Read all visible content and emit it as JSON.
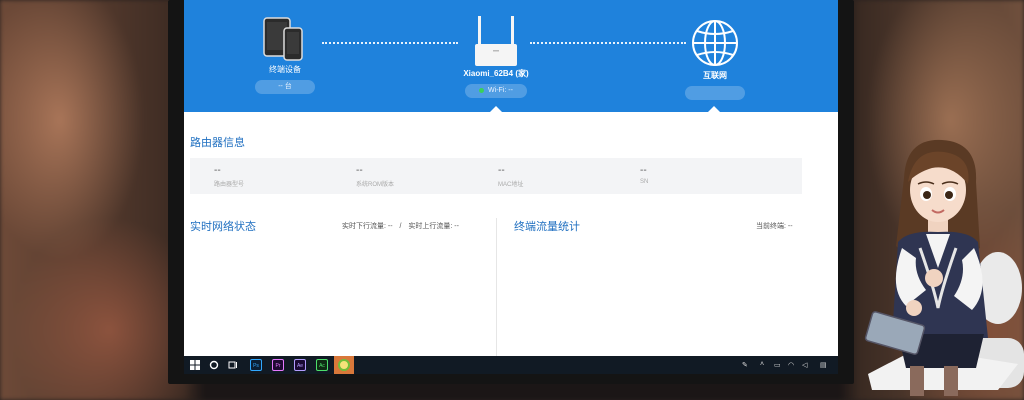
{
  "topology": {
    "devices": {
      "label": "终端设备",
      "count": "-- 台"
    },
    "router": {
      "label": "Xiaomi_62B4 (家)",
      "status": "Wi-Fi: --"
    },
    "internet": {
      "label": "互联网",
      "status": ""
    }
  },
  "router_info": {
    "title": "路由器信息",
    "items": [
      {
        "value": "--",
        "key": "路由器型号"
      },
      {
        "value": "--",
        "key": "系统ROM版本"
      },
      {
        "value": "--",
        "key": "MAC地址"
      },
      {
        "value": "--",
        "key": "SN"
      }
    ]
  },
  "network_status": {
    "title": "实时网络状态",
    "down": "实时下行流量: --",
    "sep": "/",
    "up": "实时上行流量: --"
  },
  "traffic": {
    "title": "终端流量统计",
    "current": "当前终端: --"
  },
  "taskbar": {
    "apps": [
      {
        "name": "Ps",
        "color": "#0b1e33",
        "fg": "#31a8ff"
      },
      {
        "name": "Pr",
        "color": "#1f0a33",
        "fg": "#e579ff"
      },
      {
        "name": "Ae",
        "color": "#1a0a33",
        "fg": "#b39dff"
      },
      {
        "name": "Ac",
        "color": "#0f2a14",
        "fg": "#4ddf6b"
      }
    ]
  },
  "colors": {
    "accent": "#1f82dc",
    "status_green": "#39d15a"
  }
}
